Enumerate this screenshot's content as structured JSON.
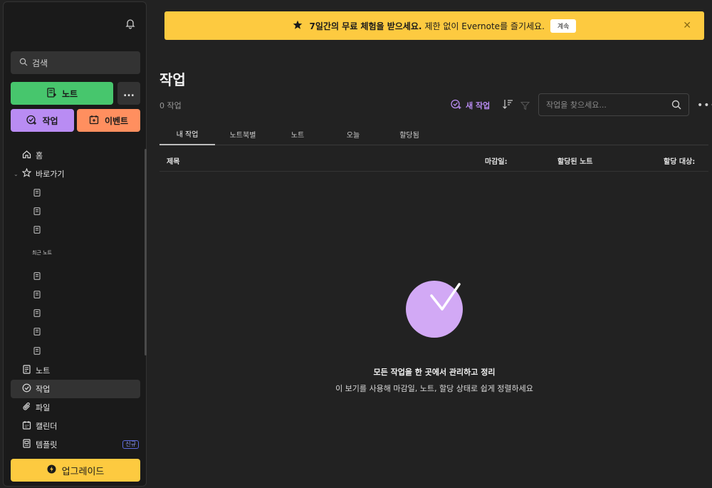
{
  "sidebar": {
    "search_label": "검색",
    "new_note_label": "노트",
    "more_label": "...",
    "new_task_label": "작업",
    "new_event_label": "이벤트",
    "nav": {
      "home": "홈",
      "shortcuts": "바로가기",
      "recent_notes": "최근 노트",
      "notes": "노트",
      "tasks": "작업",
      "files": "파일",
      "calendar": "캘린더",
      "templates": "템플릿",
      "templates_badge": "신규"
    },
    "upgrade_label": "업그레이드"
  },
  "banner": {
    "bold_text": "7일간의 무료 체험을 받으세요.",
    "rest_text": "제한 없이 Evernote를 즐기세요.",
    "continue_label": "계속"
  },
  "main": {
    "title": "작업",
    "count": "0 작업",
    "new_task_label": "새 작업",
    "search_placeholder": "작업을 찾으세요...",
    "tabs": [
      "내 작업",
      "노트북별",
      "노트",
      "오늘",
      "할당됨"
    ],
    "columns": {
      "title": "제목",
      "due": "마감일:",
      "note": "할당된 노트",
      "assignee": "할당 대상:"
    },
    "empty_title": "모든 작업을 한 곳에서 관리하고 정리",
    "empty_desc": "이 보기를 사용해 마감일, 노트, 할당 상태로 쉽게 정렬하세요"
  },
  "colors": {
    "green": "#47c66d",
    "purple": "#b98cf3",
    "orange": "#ff8f5f",
    "yellow": "#fdca40"
  }
}
